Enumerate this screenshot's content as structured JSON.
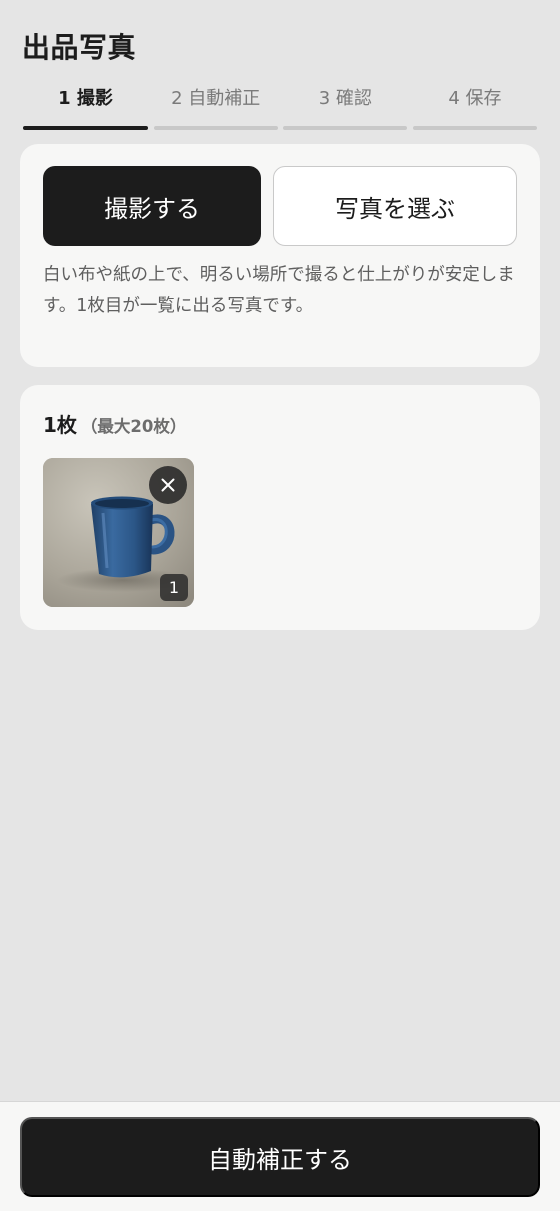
{
  "header": {
    "title": "出品写真"
  },
  "steps": [
    {
      "label": "1 撮影",
      "active": true
    },
    {
      "label": "2 自動補正",
      "active": false
    },
    {
      "label": "3 確認",
      "active": false
    },
    {
      "label": "4 保存",
      "active": false
    }
  ],
  "capture": {
    "take_photo_label": "撮影する",
    "choose_photo_label": "写真を選ぶ",
    "hint": "白い布や紙の上で、明るい場所で撮ると仕上がりが安定します。1枚目が一覧に出る写真です。"
  },
  "photos": {
    "count_label": "1枚",
    "max_label": "（最大20枚）",
    "items": [
      {
        "index": "1",
        "subject": "blue mug",
        "remove_icon": "close-icon"
      }
    ]
  },
  "footer": {
    "cta_label": "自動補正する"
  },
  "colors": {
    "background": "#e5e5e5",
    "card": "#f7f7f6",
    "primary": "#1c1c1c",
    "muted_text": "#5f5f5f",
    "inactive_step": "#c8c8c8",
    "mug_blue": "#2f5a8c"
  }
}
